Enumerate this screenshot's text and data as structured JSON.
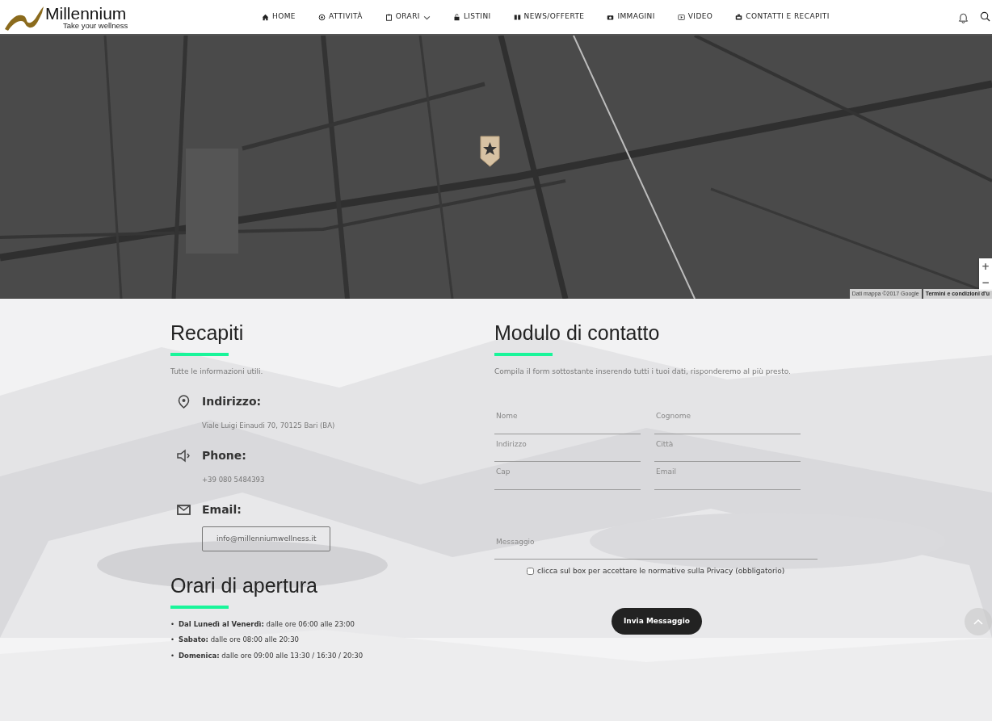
{
  "header": {
    "logo": {
      "title": "Millennium",
      "tagline": "Take your wellness"
    },
    "nav": [
      {
        "label": "HOME",
        "has_menu": false
      },
      {
        "label": "ATTIVITÀ",
        "has_menu": false
      },
      {
        "label": "ORARI",
        "has_menu": true
      },
      {
        "label": "LISTINI",
        "has_menu": false
      },
      {
        "label": "NEWS/OFFERTE",
        "has_menu": false
      },
      {
        "label": "IMMAGINI",
        "has_menu": false
      },
      {
        "label": "VIDEO",
        "has_menu": false
      },
      {
        "label": "CONTATTI E RECAPITI",
        "has_menu": false
      }
    ]
  },
  "map": {
    "kind": "picture",
    "zoom_in": "+",
    "zoom_out": "−",
    "attribution": "Dati mappa ©2017 Google",
    "terms": "Termini e condizioni d'u"
  },
  "contacts": {
    "title": "Recapiti",
    "subtitle": "Tutte le informazioni utili.",
    "items": [
      {
        "label": "Indirizzo:",
        "value": "Viale Luigi Einaudi 70, 70125 Bari (BA)",
        "kind": "text"
      },
      {
        "label": "Phone:",
        "value": "+39 080 5484393",
        "kind": "text"
      },
      {
        "label": "Email:",
        "value": "info@millenniumwellness.it",
        "kind": "button"
      }
    ]
  },
  "hours": {
    "title": "Orari di apertura",
    "items": [
      {
        "bullet": "•",
        "text": "**Dal Lunedì al Venerdì:** dalle ore 06:00 alle 23:00"
      },
      {
        "bullet": "•",
        "text": "**Sabato:** dalle ore 08:00 alle 20:30"
      },
      {
        "bullet": "•",
        "text": "**Domenica:** dalle ore 09:00 alle 13:30 / 16:30 / 20:30"
      }
    ]
  },
  "form": {
    "title": "Modulo di contatto",
    "subtitle": "Compila il form sottostante inserendo tutti i tuoi dati, risponderemo al più presto.",
    "fields": [
      {
        "placeholder": "Nome"
      },
      {
        "placeholder": "Cognome"
      },
      {
        "placeholder": "Indirizzo"
      },
      {
        "placeholder": "Città"
      },
      {
        "placeholder": "Cap"
      },
      {
        "placeholder": "Email"
      }
    ],
    "message": {
      "placeholder": "Messaggio"
    },
    "privacy": {
      "label": "clicca sul box per accettare le normative sulla Privacy (obbligatorio)",
      "checked": false
    },
    "submit": "Invia Messaggio"
  }
}
